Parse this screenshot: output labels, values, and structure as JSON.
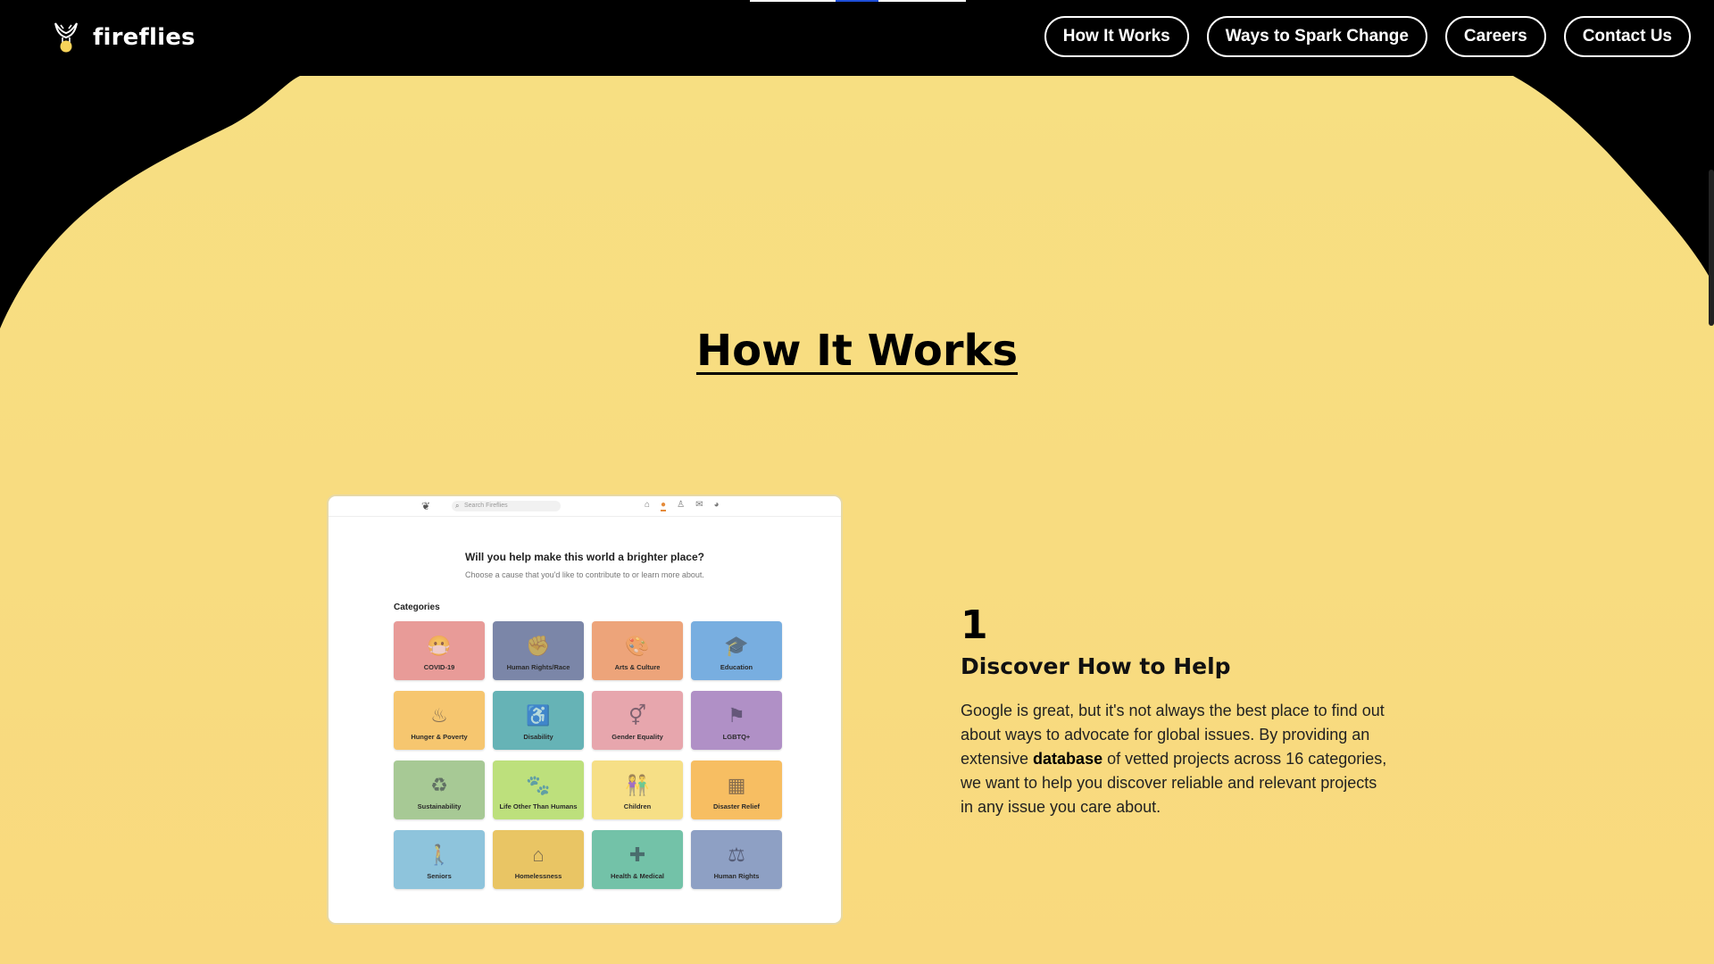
{
  "brand": {
    "name": "fireflies"
  },
  "nav": {
    "items": [
      "How It Works",
      "Ways to Spark Change",
      "Careers",
      "Contact Us"
    ]
  },
  "section": {
    "title": "How It Works"
  },
  "preview": {
    "search_placeholder": "Search Fireflies",
    "question": "Will you help make this world a brighter place?",
    "subtitle": "Choose a cause that you'd like to contribute to or learn more about.",
    "categories_label": "Categories",
    "categories": [
      {
        "label": "COVID-19",
        "color": "#e89b98",
        "icon": "mask-icon"
      },
      {
        "label": "Human Rights/Race",
        "color": "#7b86a8",
        "icon": "fist-icon"
      },
      {
        "label": "Arts & Culture",
        "color": "#eda47a",
        "icon": "palette-icon"
      },
      {
        "label": "Education",
        "color": "#78aee0",
        "icon": "graduation-cap-icon"
      },
      {
        "label": "Hunger & Poverty",
        "color": "#f6c66f",
        "icon": "bowl-icon"
      },
      {
        "label": "Disability",
        "color": "#66b3b6",
        "icon": "wheelchair-icon"
      },
      {
        "label": "Gender Equality",
        "color": "#e7a6ad",
        "icon": "gender-icon"
      },
      {
        "label": "LGBTQ+",
        "color": "#b090c6",
        "icon": "flag-icon"
      },
      {
        "label": "Sustainability",
        "color": "#a7c995",
        "icon": "recycle-icon"
      },
      {
        "label": "Life Other Than Humans",
        "color": "#bde07c",
        "icon": "paw-icon"
      },
      {
        "label": "Children",
        "color": "#f6df86",
        "icon": "children-icon"
      },
      {
        "label": "Disaster Relief",
        "color": "#f7be62",
        "icon": "building-icon"
      },
      {
        "label": "Seniors",
        "color": "#8ec4dc",
        "icon": "senior-icon"
      },
      {
        "label": "Homelessness",
        "color": "#e9c564",
        "icon": "shelter-icon"
      },
      {
        "label": "Health & Medical",
        "color": "#73c2a8",
        "icon": "medkit-icon"
      },
      {
        "label": "Human Rights",
        "color": "#8ea0c4",
        "icon": "scales-icon"
      }
    ]
  },
  "step": {
    "number": "1",
    "title": "Discover How to Help",
    "body_before": "Google is great, but it's not always the best place to find out about ways to advocate for global issues. By providing an extensive ",
    "body_bold": "database",
    "body_after": " of vetted projects across 16 categories, we want to help you discover reliable and relevant projects in any issue you care about."
  },
  "colors": {
    "background": "#000000",
    "blob": "#f7df82",
    "accent": "#e58b3a"
  }
}
